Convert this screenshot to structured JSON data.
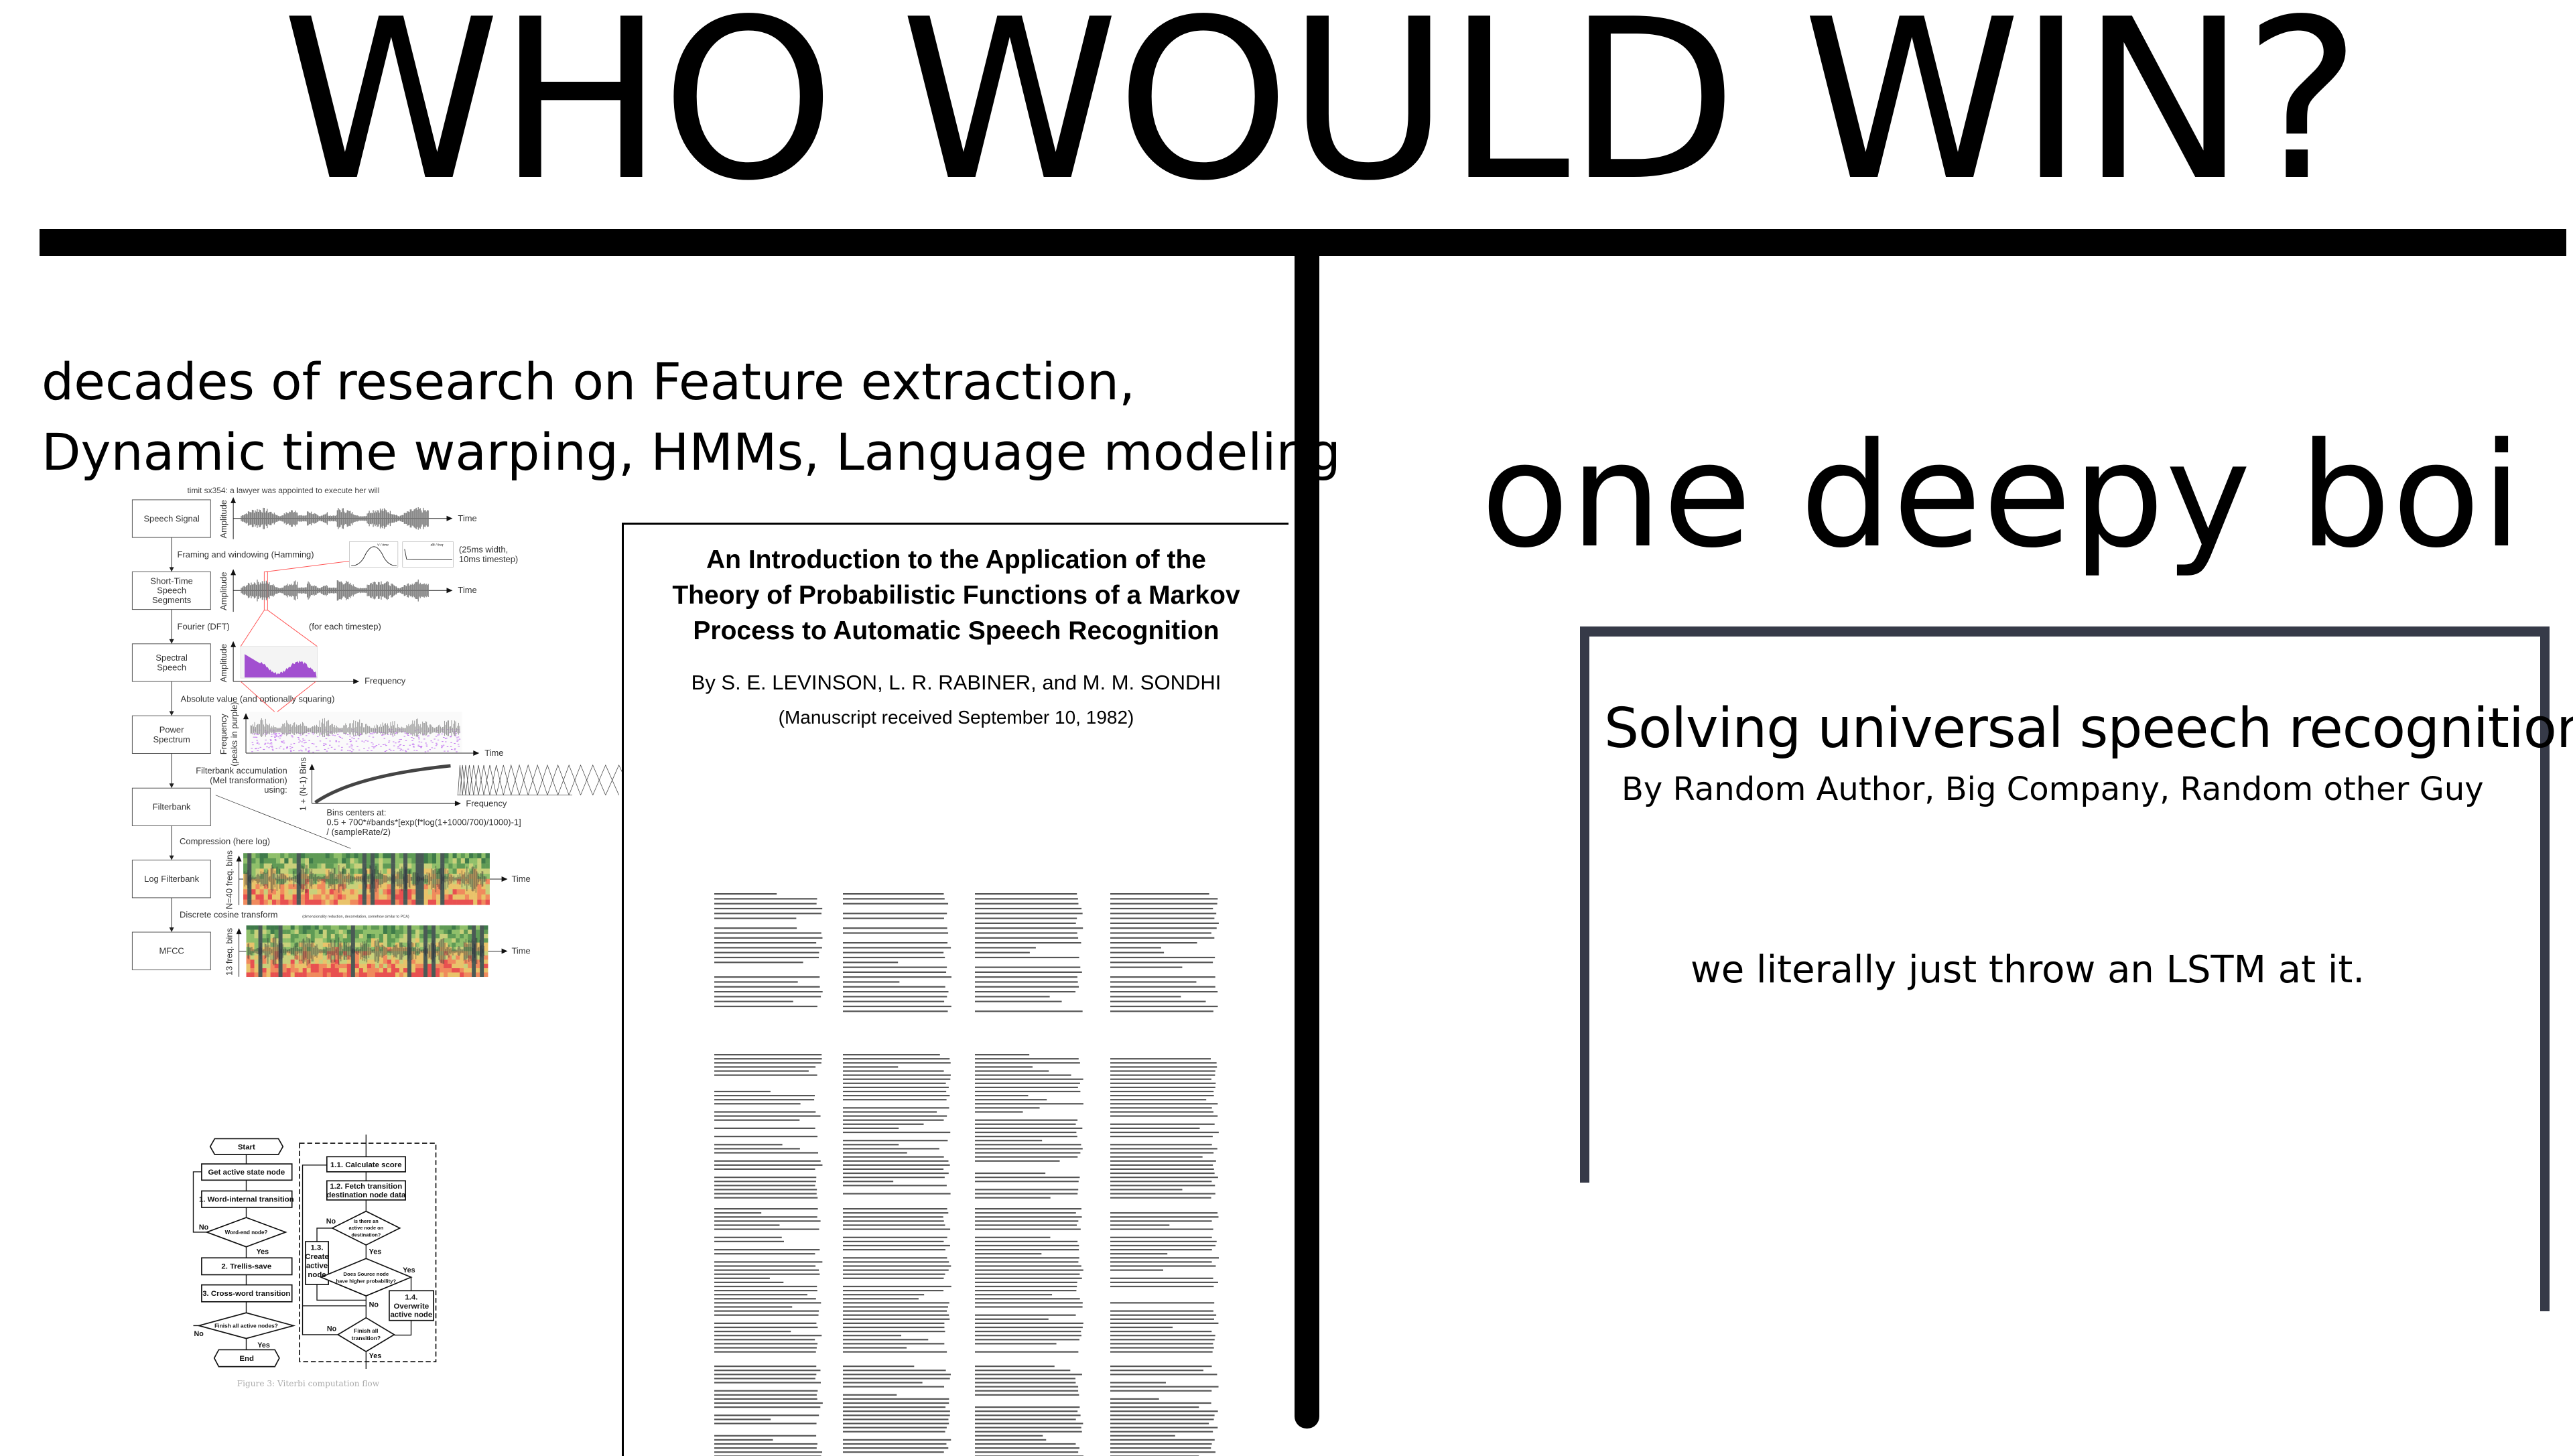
{
  "meme": {
    "title": "WHO WOULD WIN?",
    "left_caption": [
      "decades of research on Feature extraction,",
      "Dynamic time warping, HMMs, Language modeling"
    ],
    "right_caption": "one deepy boi"
  },
  "pipeline": {
    "caption": "timit sx354: a lawyer was appointed to execute her will",
    "boxes": [
      "Speech Signal",
      [
        "Short-Time",
        "Speech",
        "Segments"
      ],
      [
        "Spectral",
        "Speech"
      ],
      [
        "Power",
        "Spectrum"
      ],
      "Filterbank",
      "Log Filterbank",
      "MFCC"
    ],
    "steps": {
      "framing": "Framing and windowing (Hamming)",
      "window_note": [
        "(25ms width,",
        "10ms timestep)"
      ],
      "window_plot_labels": [
        "V / time",
        "dB / freq"
      ],
      "fourier": "Fourier (DFT)",
      "each_timestep": "(for each timestep)",
      "absolute": "Absolute value (and optionally squaring)",
      "filterbank": [
        "Filterbank accumulation",
        "(Mel transformation)",
        "using:"
      ],
      "bins": [
        "Bins centers at:",
        "0.5 + 700*#bands*[exp(f*log(1+1000/700)/1000)-1]",
        "/ (sampleRate/2)"
      ],
      "compression": "Compression (here log)",
      "dct": "Discrete cosine transform",
      "dct_note": "(dimensionality reduction, decorrelation, somehow similar to PCA)"
    },
    "axes": {
      "amplitude": "Amplitude",
      "time": "Time",
      "frequency": "Frequency",
      "power_y": [
        "Frequency",
        "(peaks in purple)"
      ],
      "mel_y": "1 + (N-1) Bins",
      "logfb_y": "N=40 freq. bins",
      "mfcc_y": "13 freq. bins"
    }
  },
  "flowchart": {
    "start": "Start",
    "get_active": "Get active state node",
    "word_internal": "1. Word-internal transition",
    "word_end": "Word-end node?",
    "trellis": "2. Trellis-save",
    "cross_word": "3. Cross-word transition",
    "finish_nodes": "Finish all active nodes?",
    "end": "End",
    "calc": "1.1. Calculate score",
    "fetch": [
      "1.2. Fetch transition",
      "destination node data"
    ],
    "is_there": [
      "Is there an",
      "active node on",
      "destination?"
    ],
    "create": [
      "1.3.",
      "Create",
      "active",
      "node"
    ],
    "does_source": [
      "Does Source node",
      "have higher probability?"
    ],
    "overwrite": [
      "1.4.",
      "Overwrite",
      "active node"
    ],
    "finish_trans": [
      "Finish all",
      "transition?"
    ],
    "yes": "Yes",
    "no": "No",
    "figure_caption": "Figure 3: Viterbi computation flow"
  },
  "paper": {
    "title": [
      "An Introduction to the Application of the",
      "Theory of Probabilistic Functions of a Markov",
      "Process to Automatic Speech Recognition"
    ],
    "authors": "By S. E. LEVINSON, L. R. RABINER, and M. M. SONDHI",
    "received": "(Manuscript received September 10, 1982)"
  },
  "new_paper": {
    "title": "Solving universal speech recognition",
    "authors": "By Random Author, Big Company, Random other Guy",
    "body": "we literally just throw an LSTM at it."
  },
  "colors": {
    "ink": "#000000",
    "box_border": "#363a48",
    "purple": "#a24fd0",
    "link_red": "#ff5a5a"
  }
}
